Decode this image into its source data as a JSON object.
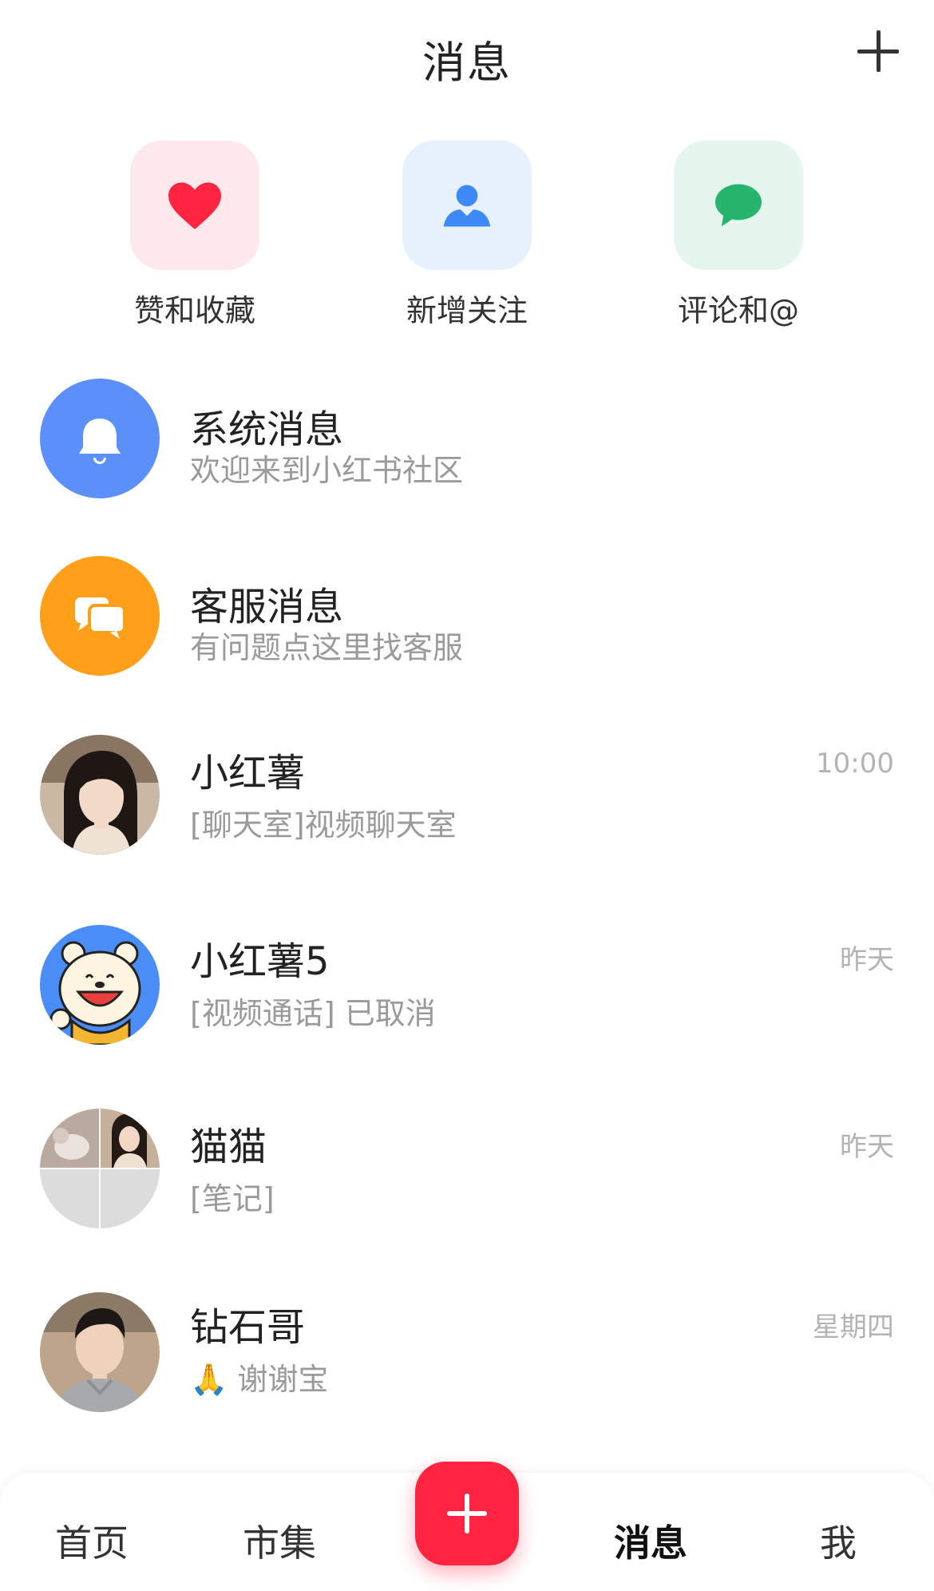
{
  "header": {
    "title": "消息",
    "add_icon": "plus-icon"
  },
  "quick_actions": [
    {
      "label": "赞和收藏",
      "icon": "heart-icon",
      "bg": "#fde8ec",
      "color": "#ff2442"
    },
    {
      "label": "新增关注",
      "icon": "person-icon",
      "bg": "#e7f0fd",
      "color": "#3d8af7"
    },
    {
      "label": "评论和@",
      "icon": "comment-icon",
      "bg": "#e5f6ee",
      "color": "#27b46d"
    }
  ],
  "messages": [
    {
      "title": "系统消息",
      "preview": "欢迎来到小红书社区",
      "time": "",
      "avatar": "bell-icon",
      "avatar_color": "#5b8ff9"
    },
    {
      "title": "客服消息",
      "preview": "有问题点这里找客服",
      "time": "",
      "avatar": "chat-bubbles-icon",
      "avatar_color": "#ff9f1a"
    },
    {
      "title": "小红薯",
      "preview": "[聊天室]视频聊天室",
      "time": "10:00",
      "avatar": "user-photo-woman"
    },
    {
      "title": "小红薯5",
      "preview": "[视频通话] 已取消",
      "time": "昨天",
      "avatar": "cartoon-bear"
    },
    {
      "title": "猫猫",
      "preview": "[笔记]",
      "time": "昨天",
      "avatar": "group-collage"
    },
    {
      "title": "钻石哥",
      "preview_emoji": "🙏",
      "preview": "谢谢宝",
      "time": "星期四",
      "avatar": "user-photo-man"
    }
  ],
  "bottom_nav": {
    "home": "首页",
    "market": "市集",
    "messages": "消息",
    "me": "我",
    "active": "messages",
    "accent": "#ff2442"
  }
}
